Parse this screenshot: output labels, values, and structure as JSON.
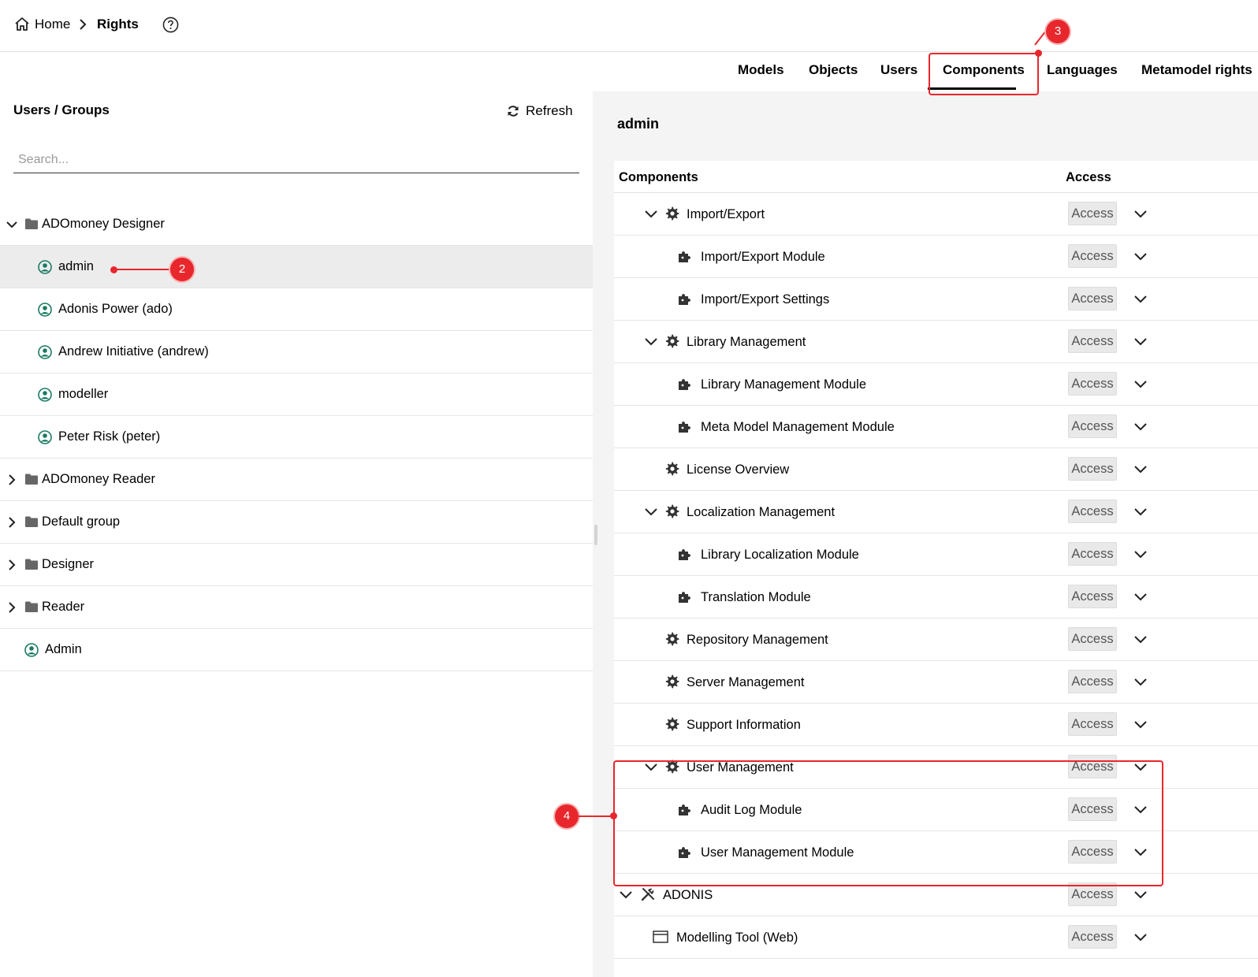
{
  "breadcrumb": {
    "home": "Home",
    "current": "Rights"
  },
  "tabs": [
    {
      "label": "Models"
    },
    {
      "label": "Objects"
    },
    {
      "label": "Users"
    },
    {
      "label": "Components",
      "active": true
    },
    {
      "label": "Languages"
    },
    {
      "label": "Metamodel rights"
    }
  ],
  "left": {
    "title": "Users / Groups",
    "refresh_label": "Refresh",
    "search_placeholder": "Search...",
    "tree": [
      {
        "type": "group",
        "label": "ADOmoney Designer",
        "expanded": true
      },
      {
        "type": "user",
        "label": "admin",
        "selected": true
      },
      {
        "type": "user",
        "label": "Adonis Power (ado)"
      },
      {
        "type": "user",
        "label": "Andrew Initiative (andrew)"
      },
      {
        "type": "user",
        "label": "modeller"
      },
      {
        "type": "user",
        "label": "Peter Risk (peter)"
      },
      {
        "type": "group",
        "label": "ADOmoney Reader",
        "expanded": false
      },
      {
        "type": "group",
        "label": "Default group",
        "expanded": false
      },
      {
        "type": "group",
        "label": "Designer",
        "expanded": false
      },
      {
        "type": "group",
        "label": "Reader",
        "expanded": false
      },
      {
        "type": "user",
        "label": "Admin"
      }
    ]
  },
  "right": {
    "selected_user": "admin",
    "col_components": "Components",
    "col_access": "Access",
    "rows": [
      {
        "label": "Import/Export",
        "icon": "gear-icon",
        "expanded": true,
        "access": "Access"
      },
      {
        "label": "Import/Export Module",
        "icon": "puzzle-icon",
        "access": "Access"
      },
      {
        "label": "Import/Export Settings",
        "icon": "puzzle-icon",
        "access": "Access"
      },
      {
        "label": "Library Management",
        "icon": "gear-icon",
        "expanded": true,
        "access": "Access"
      },
      {
        "label": "Library Management Module",
        "icon": "puzzle-icon",
        "access": "Access"
      },
      {
        "label": "Meta Model Management Module",
        "icon": "puzzle-icon",
        "access": "Access"
      },
      {
        "label": "License Overview",
        "icon": "gear-icon",
        "access": "Access"
      },
      {
        "label": "Localization Management",
        "icon": "gear-icon",
        "expanded": true,
        "access": "Access"
      },
      {
        "label": "Library Localization Module",
        "icon": "puzzle-icon",
        "access": "Access"
      },
      {
        "label": "Translation Module",
        "icon": "puzzle-icon",
        "access": "Access"
      },
      {
        "label": "Repository Management",
        "icon": "gear-icon",
        "access": "Access"
      },
      {
        "label": "Server Management",
        "icon": "gear-icon",
        "access": "Access"
      },
      {
        "label": "Support Information",
        "icon": "gear-icon",
        "access": "Access"
      },
      {
        "label": "User Management",
        "icon": "gear-icon",
        "expanded": true,
        "access": "Access"
      },
      {
        "label": "Audit Log Module",
        "icon": "puzzle-icon",
        "access": "Access"
      },
      {
        "label": "User Management Module",
        "icon": "puzzle-icon",
        "access": "Access"
      },
      {
        "label": "ADONIS",
        "icon": "tools-icon",
        "expanded": true,
        "access": "Access"
      },
      {
        "label": "Modelling Tool (Web)",
        "icon": "window-icon",
        "access": "Access"
      }
    ]
  },
  "annotations": {
    "a2": "2",
    "a3": "3",
    "a4": "4",
    "color": "#e8272d"
  }
}
